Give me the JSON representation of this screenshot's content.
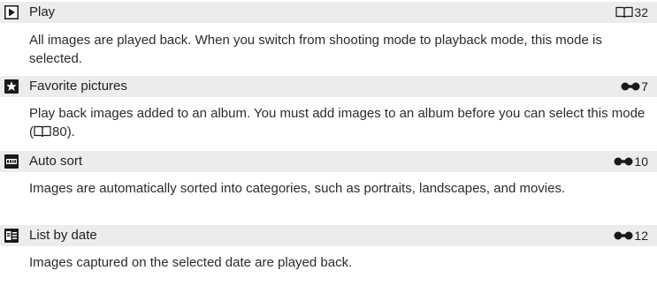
{
  "entries": [
    {
      "icon": "playback-triangle-icon",
      "title": "Play",
      "ref_icon": "book-icon",
      "ref_page": "32",
      "description": "All images are played back. When you switch from shooting mode to playback mode, this mode is selected."
    },
    {
      "icon": "favorite-star-icon",
      "title": "Favorite pictures",
      "ref_icon": "reference-section-icon",
      "ref_page": "7",
      "description_before": "Play back images added to an album. You must add images to an album before you can select this mode (",
      "description_inline_icon": "book-icon",
      "description_page": "80",
      "description_after": ")."
    },
    {
      "icon": "auto-sort-icon",
      "title": "Auto sort",
      "ref_icon": "reference-section-icon",
      "ref_page": "10",
      "description": "Images are automatically sorted into categories, such as portraits, landscapes, and movies."
    },
    {
      "icon": "list-by-date-icon",
      "title": "List by date",
      "ref_icon": "reference-section-icon",
      "ref_page": "12",
      "description": "Images captured on the selected date are played back."
    }
  ],
  "colors": {
    "header_background": "#ececec",
    "text": "#2b2b2b",
    "icon_dark": "#1a1a1a"
  }
}
